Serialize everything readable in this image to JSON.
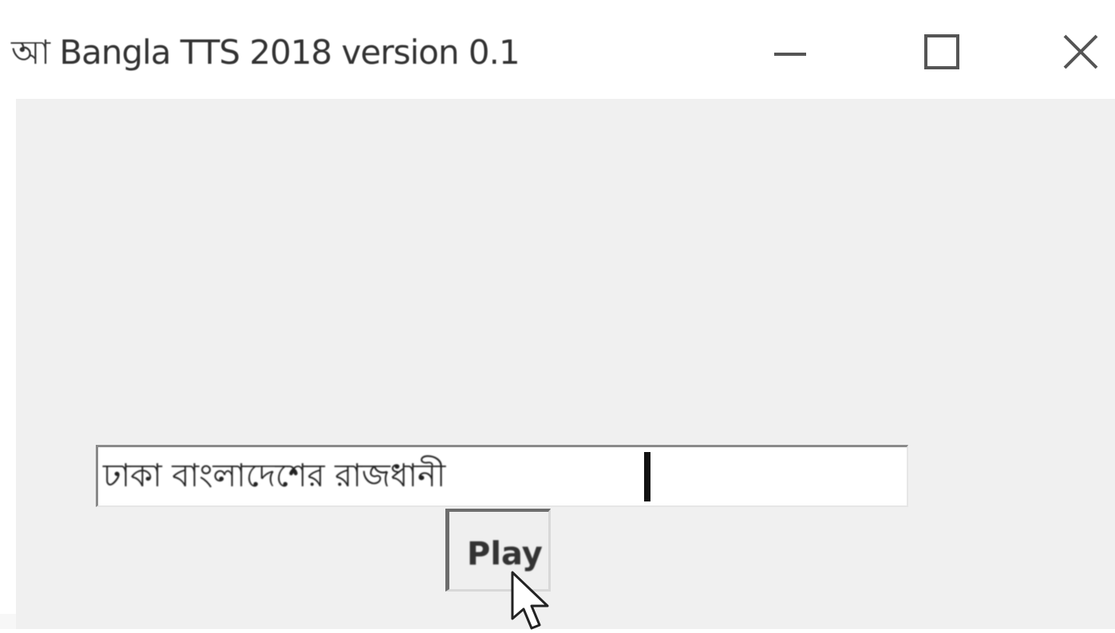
{
  "window": {
    "title": "আ Bangla TTS 2018 version 0.1"
  },
  "titlebar": {
    "minimize_icon": "minimize-icon",
    "maximize_icon": "maximize-icon",
    "close_icon": "close-icon"
  },
  "input": {
    "value": "ঢাকা বাংলাদেশের রাজধানী"
  },
  "play_button": {
    "label": "Play"
  },
  "colors": {
    "client_background": "#f0f0f0",
    "titlebar_background": "#ffffff",
    "text": "#333333"
  }
}
